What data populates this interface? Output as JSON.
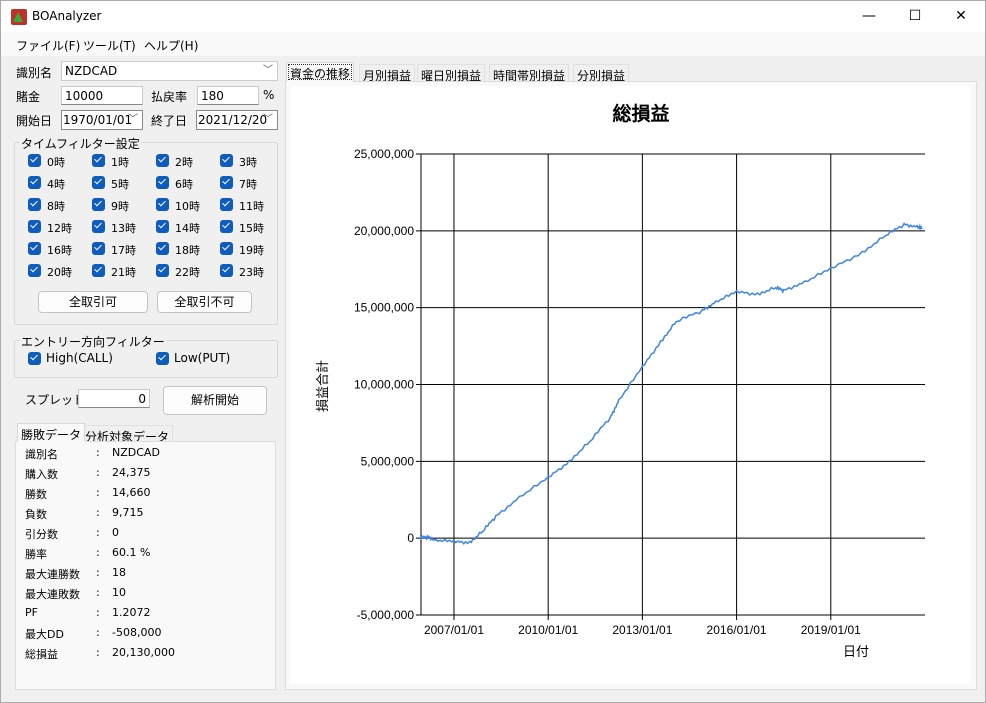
{
  "window": {
    "title": "BOAnalyzer",
    "minimize": "—",
    "maximize": "☐",
    "close": "✕"
  },
  "menu": [
    "ファイル(F)",
    "ツール(T)",
    "ヘルプ(H)"
  ],
  "form": {
    "identifier_label": "識別名",
    "identifier_value": "NZDCAD",
    "stake_label": "賭金",
    "stake_value": "10000",
    "payout_label": "払戻率",
    "payout_value": "180",
    "payout_unit": "%",
    "start_label": "開始日",
    "start_value": "1970/01/01",
    "end_label": "終了日",
    "end_value": "2021/12/20"
  },
  "time_filter": {
    "title": "タイムフィルター設定",
    "hours": [
      "0時",
      "1時",
      "2時",
      "3時",
      "4時",
      "5時",
      "6時",
      "7時",
      "8時",
      "9時",
      "10時",
      "11時",
      "12時",
      "13時",
      "14時",
      "15時",
      "16時",
      "17時",
      "18時",
      "19時",
      "20時",
      "21時",
      "22時",
      "23時"
    ],
    "all_on": "全取引可",
    "all_off": "全取引不可"
  },
  "direction_filter": {
    "title": "エントリー方向フィルター",
    "high": "High(CALL)",
    "low": "Low(PUT)"
  },
  "spread": {
    "label": "スプレッド",
    "value": "0",
    "run": "解析開始"
  },
  "result_tabs": [
    "勝敗データ",
    "分析対象データ"
  ],
  "results": [
    {
      "k": "識別名",
      "v": "NZDCAD"
    },
    {
      "k": "購入数",
      "v": "24,375"
    },
    {
      "k": "勝数",
      "v": "14,660"
    },
    {
      "k": "負数",
      "v": "9,715"
    },
    {
      "k": "引分数",
      "v": "0"
    },
    {
      "k": "勝率",
      "v": "60.1 %"
    },
    {
      "k": "最大連勝数",
      "v": "18"
    },
    {
      "k": "最大連敗数",
      "v": "10"
    },
    {
      "k": "PF",
      "v": "1.2072"
    },
    {
      "k": "最大DD",
      "v": "-508,000"
    },
    {
      "k": "総損益",
      "v": "20,130,000"
    }
  ],
  "chart_tabs": [
    "資金の推移",
    "月別損益",
    "曜日別損益",
    "時間帯別損益",
    "分別損益"
  ],
  "chart_data": {
    "type": "line",
    "title": "総損益",
    "xlabel": "日付",
    "ylabel": "損益合計",
    "ylim": [
      -5000000,
      25000000
    ],
    "yticks": [
      "-5,000,000",
      "0",
      "5,000,000",
      "10,000,000",
      "15,000,000",
      "20,000,000",
      "25,000,000"
    ],
    "xticks": [
      "2007/01/01",
      "2010/01/01",
      "2013/01/01",
      "2016/01/01",
      "2019/01/01"
    ],
    "grid": true,
    "color": "#3d85e6",
    "points": [
      [
        "2005-12",
        0
      ],
      [
        "2006-03",
        70000
      ],
      [
        "2006-06",
        -100000
      ],
      [
        "2007-01",
        -260000
      ],
      [
        "2007-07",
        -260000
      ],
      [
        "2007-12",
        450000
      ],
      [
        "2008-05",
        1400000
      ],
      [
        "2009-02",
        2700000
      ],
      [
        "2010-01",
        3900000
      ],
      [
        "2010-09",
        5000000
      ],
      [
        "2011-05",
        6300000
      ],
      [
        "2012-01",
        7900000
      ],
      [
        "2012-04",
        9000000
      ],
      [
        "2013-01",
        11100000
      ],
      [
        "2013-08",
        12800000
      ],
      [
        "2014-02",
        14100000
      ],
      [
        "2014-12",
        14800000
      ],
      [
        "2015-05",
        15400000
      ],
      [
        "2016-01",
        16000000
      ],
      [
        "2016-09",
        15900000
      ],
      [
        "2017-04",
        16300000
      ],
      [
        "2017-07",
        16100000
      ],
      [
        "2018-03",
        16700000
      ],
      [
        "2019-01",
        17500000
      ],
      [
        "2020-01",
        18600000
      ],
      [
        "2020-10",
        19700000
      ],
      [
        "2021-05",
        20400000
      ],
      [
        "2021-10",
        20300000
      ],
      [
        "2021-12",
        20130000
      ]
    ]
  }
}
